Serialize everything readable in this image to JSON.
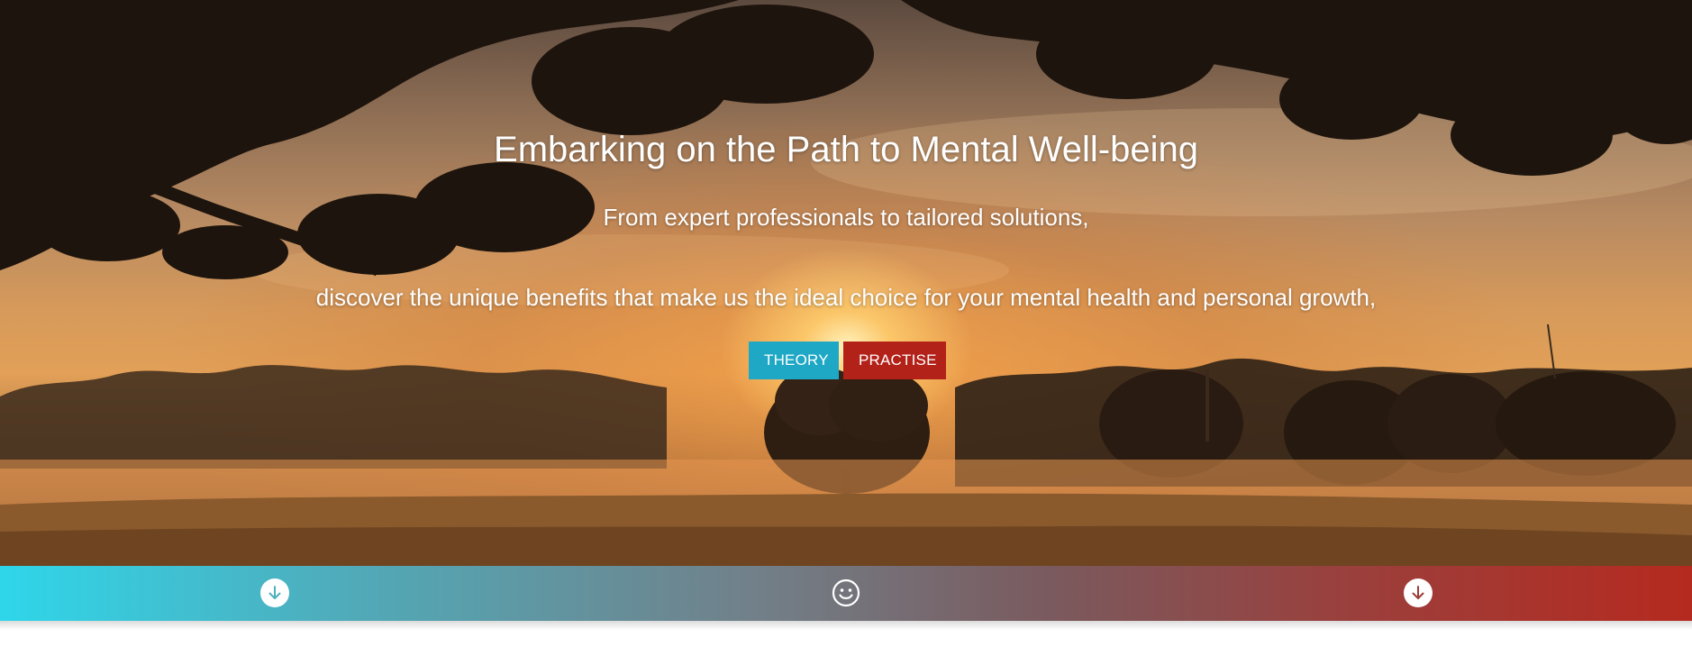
{
  "hero": {
    "title": "Embarking on the Path to Mental Well-being",
    "subtitle_line1": "From expert professionals to tailored solutions,",
    "subtitle_line2": "discover the unique benefits that make us the ideal choice for your mental health and personal growth,",
    "buttons": [
      {
        "label": "THEORY",
        "color": "#1ea8c6"
      },
      {
        "label": "PRACTISE",
        "color": "#b32219"
      }
    ]
  },
  "bottom_bar": {
    "gradient_colors": [
      "#2fd6ea",
      "#7a5a5e",
      "#b52a1f"
    ],
    "icons": [
      {
        "name": "arrow-down-circle-icon"
      },
      {
        "name": "smiley-face-icon"
      },
      {
        "name": "arrow-down-circle-icon"
      }
    ]
  }
}
